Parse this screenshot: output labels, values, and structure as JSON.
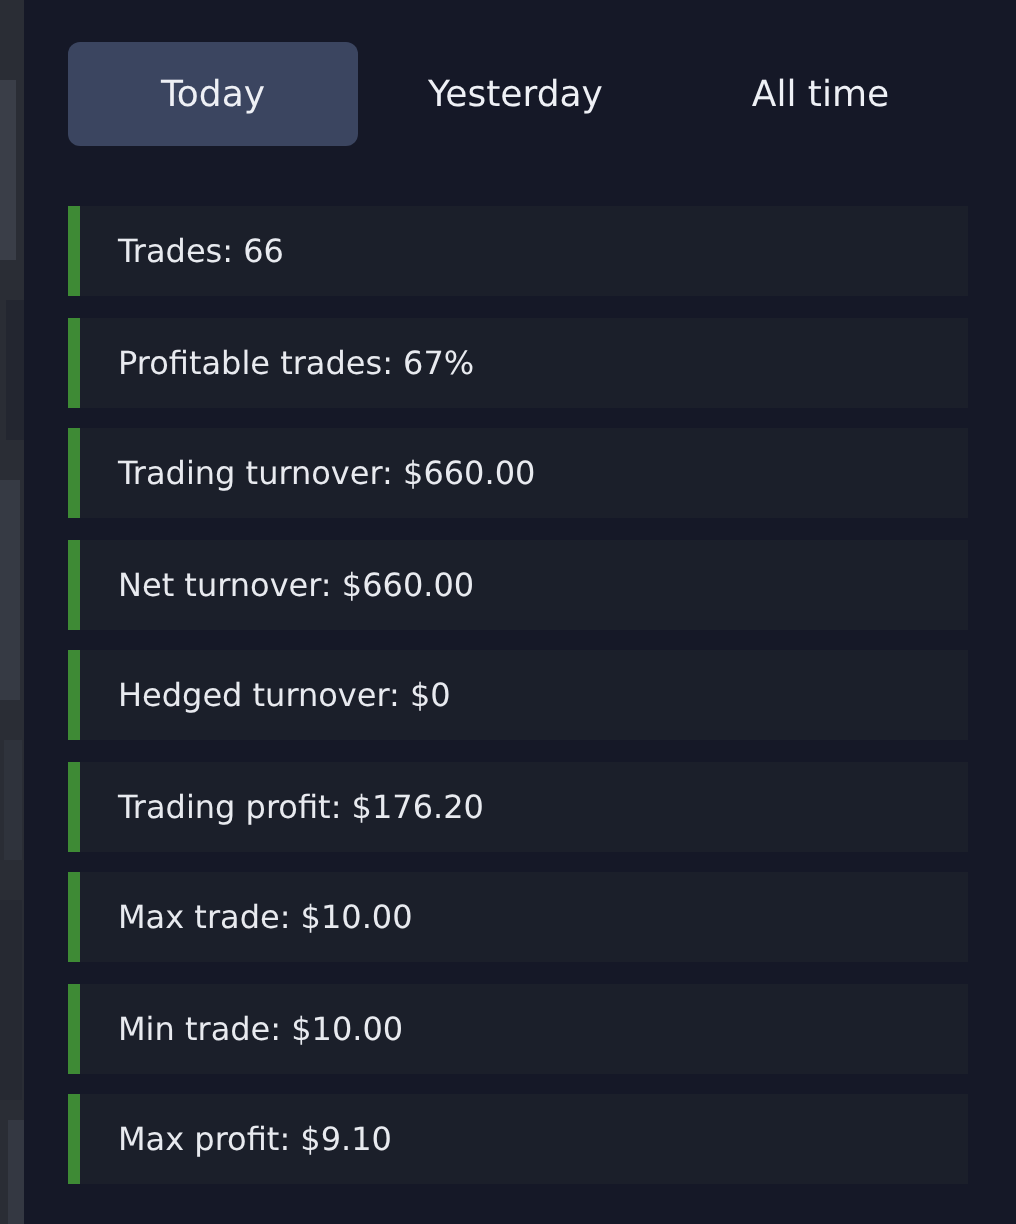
{
  "tabs": [
    {
      "label": "Today",
      "selected": true
    },
    {
      "label": "Yesterday",
      "selected": false
    },
    {
      "label": "All time",
      "selected": false
    }
  ],
  "stats": [
    {
      "label": "Trades: 66"
    },
    {
      "label": "Profitable trades: 67%"
    },
    {
      "label": "Trading turnover: $660.00"
    },
    {
      "label": "Net turnover: $660.00"
    },
    {
      "label": "Hedged turnover: $0"
    },
    {
      "label": "Trading profit: $176.20"
    },
    {
      "label": "Max trade: $10.00"
    },
    {
      "label": "Min trade: $10.00"
    },
    {
      "label": "Max profit: $9.10"
    }
  ]
}
